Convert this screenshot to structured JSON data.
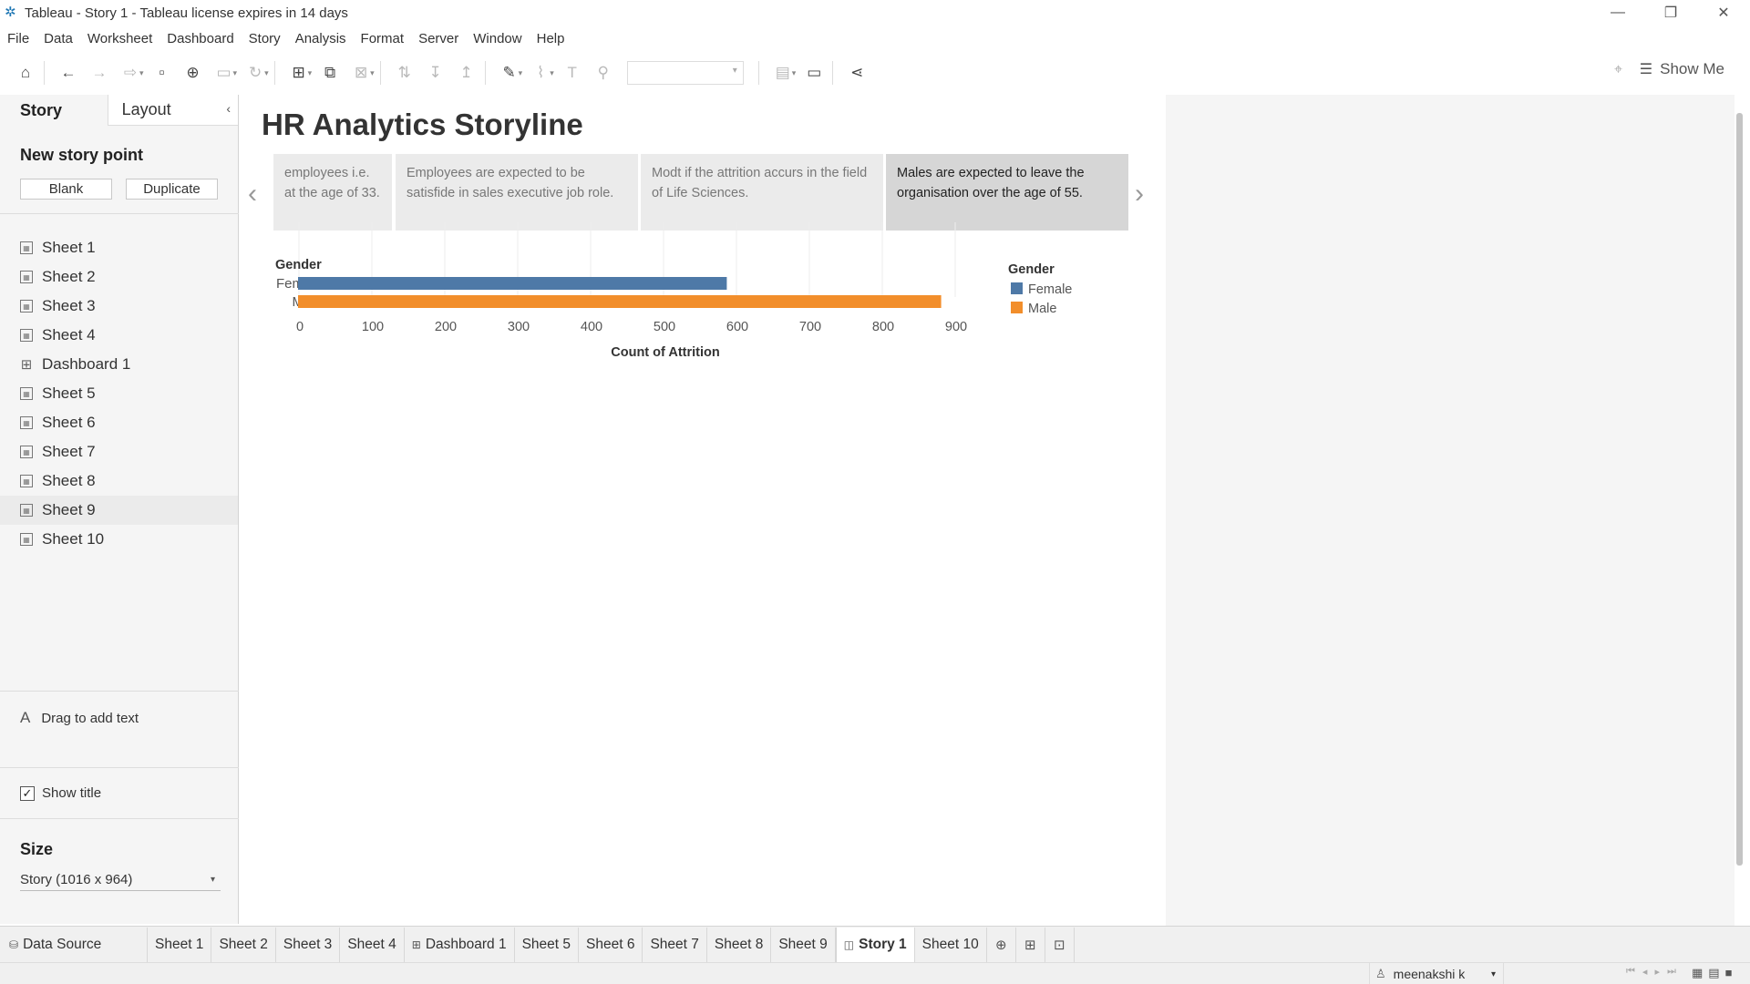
{
  "window": {
    "title": "Tableau - Story 1 - Tableau license expires in 14 days"
  },
  "menu": [
    "File",
    "Data",
    "Worksheet",
    "Dashboard",
    "Story",
    "Analysis",
    "Format",
    "Server",
    "Window",
    "Help"
  ],
  "toolbar": {
    "show_me": "Show Me"
  },
  "left_pane": {
    "tabs": {
      "story": "Story",
      "layout": "Layout"
    },
    "new_story_point": "New story point",
    "blank_button": "Blank",
    "duplicate_button": "Duplicate",
    "sheets": [
      {
        "label": "Sheet 1",
        "type": "sheet"
      },
      {
        "label": "Sheet 2",
        "type": "sheet"
      },
      {
        "label": "Sheet 3",
        "type": "sheet"
      },
      {
        "label": "Sheet 4",
        "type": "sheet"
      },
      {
        "label": "Dashboard 1",
        "type": "dashboard"
      },
      {
        "label": "Sheet 5",
        "type": "sheet"
      },
      {
        "label": "Sheet 6",
        "type": "sheet"
      },
      {
        "label": "Sheet 7",
        "type": "sheet"
      },
      {
        "label": "Sheet 8",
        "type": "sheet"
      },
      {
        "label": "Sheet 9",
        "type": "sheet"
      },
      {
        "label": "Sheet 10",
        "type": "sheet"
      }
    ],
    "drag_text": "Drag to add text",
    "show_title": "Show title",
    "show_title_checked": true,
    "size_title": "Size",
    "size_value": "Story (1016 x 964)"
  },
  "story": {
    "title": "HR Analytics Storyline",
    "captions": [
      {
        "text": "employees i.e. at the age of 33.",
        "active": false
      },
      {
        "text": "Employees are expected to be satisfide in sales executive job role.",
        "active": false
      },
      {
        "text": "Modt if the attrition accurs in the field of Life Sciences.",
        "active": false
      },
      {
        "text": "Males are expected to leave the organisation over the age of 55.",
        "active": true
      }
    ]
  },
  "chart_data": {
    "type": "bar",
    "orientation": "horizontal",
    "row_header": "Gender",
    "categories": [
      "Female",
      "Male"
    ],
    "values": [
      588,
      882
    ],
    "colors": [
      "#4e79a7",
      "#f28e2b"
    ],
    "xlabel": "Count of Attrition",
    "xlim": [
      0,
      900
    ],
    "xticks": [
      0,
      100,
      200,
      300,
      400,
      500,
      600,
      700,
      800,
      900
    ],
    "legend": {
      "title": "Gender",
      "items": [
        {
          "label": "Female",
          "color": "#4e79a7"
        },
        {
          "label": "Male",
          "color": "#f28e2b"
        }
      ],
      "placement": "right"
    },
    "grid": true
  },
  "bottom_tabs": [
    {
      "label": "Data Source",
      "kind": "datasource"
    },
    {
      "label": "Sheet 1",
      "kind": "sheet"
    },
    {
      "label": "Sheet 2",
      "kind": "sheet"
    },
    {
      "label": "Sheet 3",
      "kind": "sheet"
    },
    {
      "label": "Sheet 4",
      "kind": "sheet"
    },
    {
      "label": "Dashboard 1",
      "kind": "dashboard"
    },
    {
      "label": "Sheet 5",
      "kind": "sheet"
    },
    {
      "label": "Sheet 6",
      "kind": "sheet"
    },
    {
      "label": "Sheet 7",
      "kind": "sheet"
    },
    {
      "label": "Sheet 8",
      "kind": "sheet"
    },
    {
      "label": "Sheet 9",
      "kind": "sheet"
    },
    {
      "label": "Story 1",
      "kind": "story",
      "active": true
    },
    {
      "label": "Sheet 10",
      "kind": "sheet"
    }
  ],
  "status": {
    "user": "meenakshi k"
  }
}
